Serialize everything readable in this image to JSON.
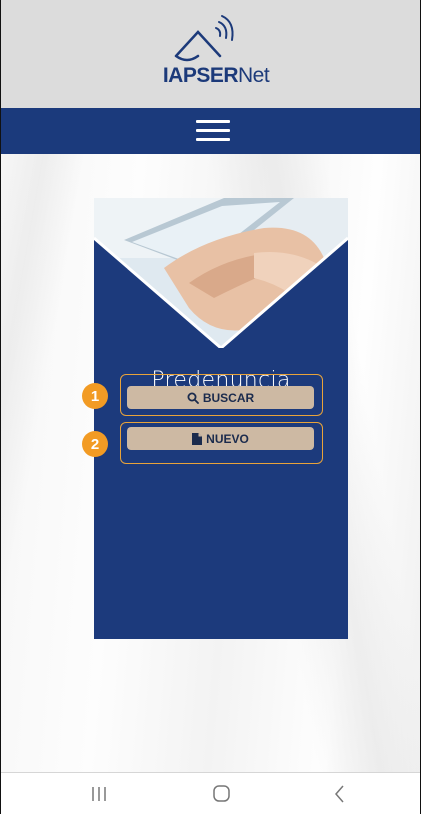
{
  "app": {
    "brand_bold": "IAPSER",
    "brand_regular": "Net"
  },
  "card": {
    "title": "Predenuncia"
  },
  "actions": [
    {
      "number": "1",
      "label": "BUSCAR",
      "icon": "search-icon"
    },
    {
      "number": "2",
      "label": "NUEVO",
      "icon": "document-icon"
    }
  ],
  "colors": {
    "navbar": "#1b3a7c",
    "card": "#1c3a7c",
    "button": "#cdb9a3",
    "highlight": "#e8a33a",
    "badge": "#f29b24"
  },
  "system_nav": [
    "recent-apps-icon",
    "home-icon",
    "back-icon"
  ]
}
